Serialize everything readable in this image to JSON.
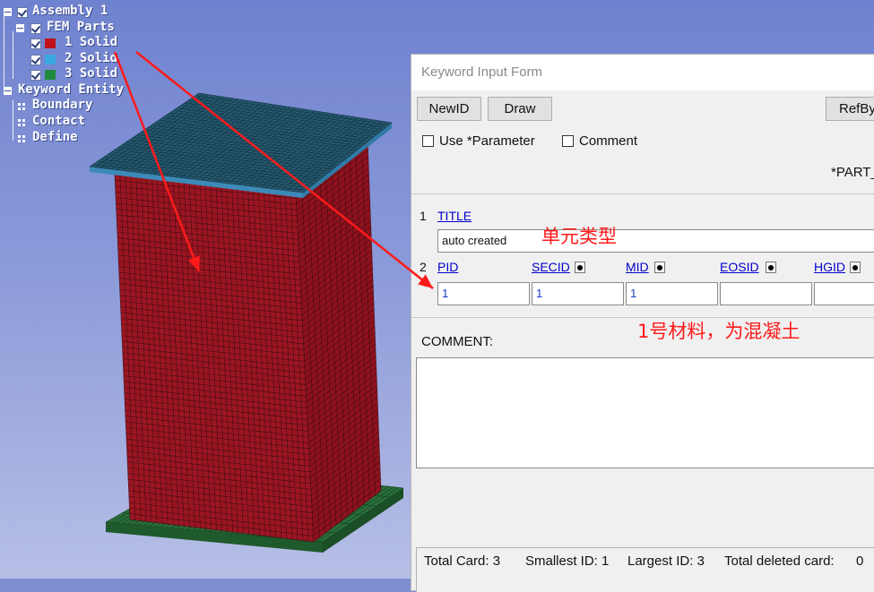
{
  "tree": {
    "assembly": "Assembly 1",
    "fem_parts": "FEM Parts",
    "parts": [
      {
        "label": "1 Solid",
        "color": "#c0101a"
      },
      {
        "label": "2 Solid",
        "color": "#3aa8e0"
      },
      {
        "label": "3 Solid",
        "color": "#1e8a3c"
      }
    ],
    "keyword_entity": "Keyword Entity",
    "children": [
      "Boundary",
      "Contact",
      "Define"
    ]
  },
  "model": {
    "body_color": "#9b1622",
    "top_plate_color": "#2f6e92",
    "bottom_plate_color": "#2a6e3a",
    "mesh_color": "#3a0a10"
  },
  "dialog": {
    "title": "Keyword Input Form",
    "buttons": {
      "newid": "NewID",
      "draw": "Draw",
      "refby": "RefBy"
    },
    "checkboxes": {
      "use_parameter": "Use *Parameter",
      "comment": "Comment"
    },
    "keyword": "*PART_",
    "card1": {
      "index": "1",
      "field": "TITLE",
      "value": "auto created"
    },
    "card2": {
      "index": "2",
      "fields": [
        {
          "label": "PID",
          "value": "1"
        },
        {
          "label": "SECID",
          "value": "1"
        },
        {
          "label": "MID",
          "value": "1"
        },
        {
          "label": "EOSID",
          "value": ""
        },
        {
          "label": "HGID",
          "value": ""
        }
      ]
    },
    "comment_label": "COMMENT:",
    "status": {
      "total_card": "Total Card: 3",
      "smallest": "Smallest ID: 1",
      "largest": "Largest ID: 3",
      "deleted": "Total deleted card:",
      "deleted_value": "0"
    }
  },
  "annotations": {
    "element_type": "单元类型",
    "material": "1号材料，为混凝土",
    "color": "#ff1a1a"
  }
}
